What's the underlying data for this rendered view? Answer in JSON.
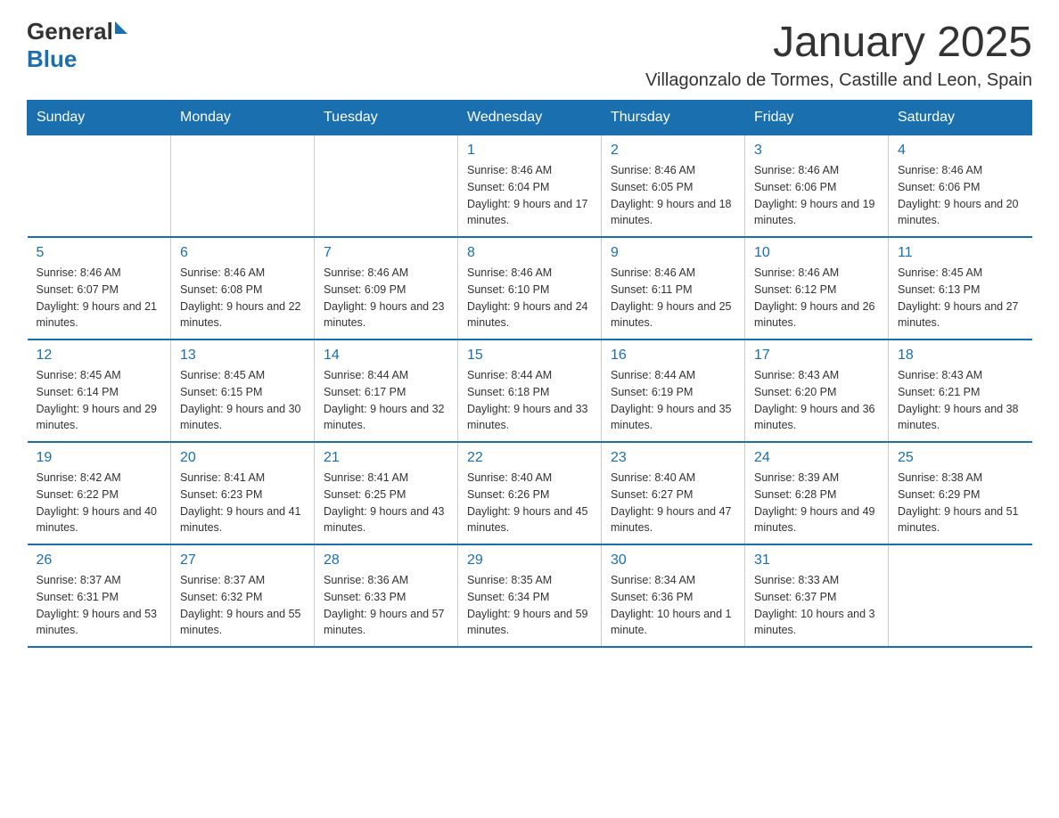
{
  "logo": {
    "general": "General",
    "blue": "Blue"
  },
  "title": "January 2025",
  "subtitle": "Villagonzalo de Tormes, Castille and Leon, Spain",
  "days_of_week": [
    "Sunday",
    "Monday",
    "Tuesday",
    "Wednesday",
    "Thursday",
    "Friday",
    "Saturday"
  ],
  "weeks": [
    [
      {
        "day": "",
        "info": ""
      },
      {
        "day": "",
        "info": ""
      },
      {
        "day": "",
        "info": ""
      },
      {
        "day": "1",
        "info": "Sunrise: 8:46 AM\nSunset: 6:04 PM\nDaylight: 9 hours and 17 minutes."
      },
      {
        "day": "2",
        "info": "Sunrise: 8:46 AM\nSunset: 6:05 PM\nDaylight: 9 hours and 18 minutes."
      },
      {
        "day": "3",
        "info": "Sunrise: 8:46 AM\nSunset: 6:06 PM\nDaylight: 9 hours and 19 minutes."
      },
      {
        "day": "4",
        "info": "Sunrise: 8:46 AM\nSunset: 6:06 PM\nDaylight: 9 hours and 20 minutes."
      }
    ],
    [
      {
        "day": "5",
        "info": "Sunrise: 8:46 AM\nSunset: 6:07 PM\nDaylight: 9 hours and 21 minutes."
      },
      {
        "day": "6",
        "info": "Sunrise: 8:46 AM\nSunset: 6:08 PM\nDaylight: 9 hours and 22 minutes."
      },
      {
        "day": "7",
        "info": "Sunrise: 8:46 AM\nSunset: 6:09 PM\nDaylight: 9 hours and 23 minutes."
      },
      {
        "day": "8",
        "info": "Sunrise: 8:46 AM\nSunset: 6:10 PM\nDaylight: 9 hours and 24 minutes."
      },
      {
        "day": "9",
        "info": "Sunrise: 8:46 AM\nSunset: 6:11 PM\nDaylight: 9 hours and 25 minutes."
      },
      {
        "day": "10",
        "info": "Sunrise: 8:46 AM\nSunset: 6:12 PM\nDaylight: 9 hours and 26 minutes."
      },
      {
        "day": "11",
        "info": "Sunrise: 8:45 AM\nSunset: 6:13 PM\nDaylight: 9 hours and 27 minutes."
      }
    ],
    [
      {
        "day": "12",
        "info": "Sunrise: 8:45 AM\nSunset: 6:14 PM\nDaylight: 9 hours and 29 minutes."
      },
      {
        "day": "13",
        "info": "Sunrise: 8:45 AM\nSunset: 6:15 PM\nDaylight: 9 hours and 30 minutes."
      },
      {
        "day": "14",
        "info": "Sunrise: 8:44 AM\nSunset: 6:17 PM\nDaylight: 9 hours and 32 minutes."
      },
      {
        "day": "15",
        "info": "Sunrise: 8:44 AM\nSunset: 6:18 PM\nDaylight: 9 hours and 33 minutes."
      },
      {
        "day": "16",
        "info": "Sunrise: 8:44 AM\nSunset: 6:19 PM\nDaylight: 9 hours and 35 minutes."
      },
      {
        "day": "17",
        "info": "Sunrise: 8:43 AM\nSunset: 6:20 PM\nDaylight: 9 hours and 36 minutes."
      },
      {
        "day": "18",
        "info": "Sunrise: 8:43 AM\nSunset: 6:21 PM\nDaylight: 9 hours and 38 minutes."
      }
    ],
    [
      {
        "day": "19",
        "info": "Sunrise: 8:42 AM\nSunset: 6:22 PM\nDaylight: 9 hours and 40 minutes."
      },
      {
        "day": "20",
        "info": "Sunrise: 8:41 AM\nSunset: 6:23 PM\nDaylight: 9 hours and 41 minutes."
      },
      {
        "day": "21",
        "info": "Sunrise: 8:41 AM\nSunset: 6:25 PM\nDaylight: 9 hours and 43 minutes."
      },
      {
        "day": "22",
        "info": "Sunrise: 8:40 AM\nSunset: 6:26 PM\nDaylight: 9 hours and 45 minutes."
      },
      {
        "day": "23",
        "info": "Sunrise: 8:40 AM\nSunset: 6:27 PM\nDaylight: 9 hours and 47 minutes."
      },
      {
        "day": "24",
        "info": "Sunrise: 8:39 AM\nSunset: 6:28 PM\nDaylight: 9 hours and 49 minutes."
      },
      {
        "day": "25",
        "info": "Sunrise: 8:38 AM\nSunset: 6:29 PM\nDaylight: 9 hours and 51 minutes."
      }
    ],
    [
      {
        "day": "26",
        "info": "Sunrise: 8:37 AM\nSunset: 6:31 PM\nDaylight: 9 hours and 53 minutes."
      },
      {
        "day": "27",
        "info": "Sunrise: 8:37 AM\nSunset: 6:32 PM\nDaylight: 9 hours and 55 minutes."
      },
      {
        "day": "28",
        "info": "Sunrise: 8:36 AM\nSunset: 6:33 PM\nDaylight: 9 hours and 57 minutes."
      },
      {
        "day": "29",
        "info": "Sunrise: 8:35 AM\nSunset: 6:34 PM\nDaylight: 9 hours and 59 minutes."
      },
      {
        "day": "30",
        "info": "Sunrise: 8:34 AM\nSunset: 6:36 PM\nDaylight: 10 hours and 1 minute."
      },
      {
        "day": "31",
        "info": "Sunrise: 8:33 AM\nSunset: 6:37 PM\nDaylight: 10 hours and 3 minutes."
      },
      {
        "day": "",
        "info": ""
      }
    ]
  ]
}
